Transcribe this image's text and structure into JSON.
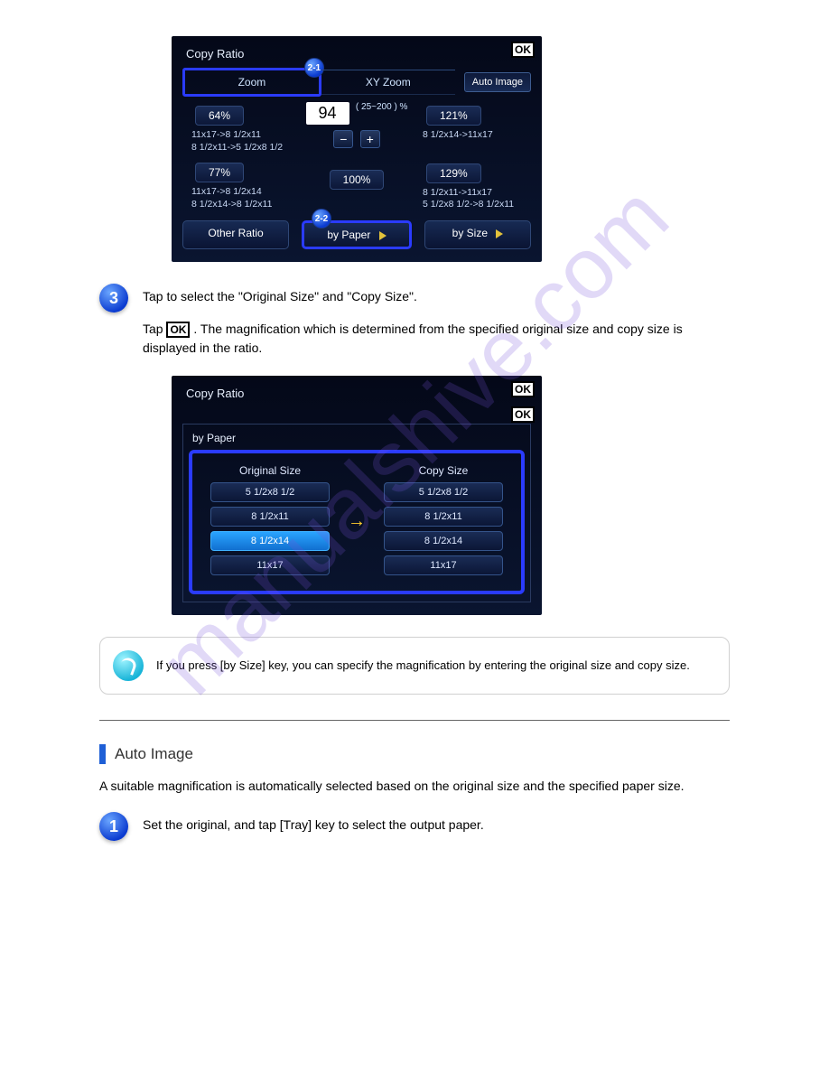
{
  "watermark": "manualshive.com",
  "screen1": {
    "title": "Copy Ratio",
    "ok": "OK",
    "marker_top": "2-1",
    "marker_bottom": "2-2",
    "tabs": {
      "zoom": "Zoom",
      "xyzoom": "XY Zoom",
      "autoimage": "Auto Image"
    },
    "left": {
      "p1": "64%",
      "d1a": "11x17->8 1/2x11",
      "d1b": "8 1/2x11->5 1/2x8 1/2",
      "p2": "77%",
      "d2a": "11x17->8 1/2x14",
      "d2b": "8 1/2x14->8 1/2x11"
    },
    "center": {
      "value": "94",
      "range": "( 25~200 )\n%",
      "minus": "−",
      "plus": "+",
      "hundred": "100%"
    },
    "right": {
      "p1": "121%",
      "d1a": "8 1/2x14->11x17",
      "p2": "129%",
      "d2a": "8 1/2x11->11x17",
      "d2b": "5 1/2x8 1/2->8 1/2x11"
    },
    "bottom": {
      "other": "Other Ratio",
      "bypaper": "by Paper",
      "bysize": "by Size"
    }
  },
  "step3": {
    "num": "3",
    "line1": "Tap to select the \"Original Size\" and \"Copy Size\".",
    "sub_prefix": "Tap ",
    "sub_ok": "OK",
    "sub_suffix": ". The magnification which is determined from the specified original size and copy size is displayed in the ratio."
  },
  "screen2": {
    "title": "Copy Ratio",
    "ok": "OK",
    "sublabel": "by Paper",
    "ok2": "OK",
    "orig_head": "Original Size",
    "copy_head": "Copy Size",
    "sizes_left": [
      "5 1/2x8 1/2",
      "8 1/2x11",
      "8 1/2x14",
      "11x17"
    ],
    "sizes_right": [
      "5 1/2x8 1/2",
      "8 1/2x11",
      "8 1/2x14",
      "11x17"
    ],
    "arrow": "→"
  },
  "note": {
    "text": "If you press [by Size] key, you can specify the magnification by entering the original size and copy size."
  },
  "section": {
    "title": "Auto Image",
    "desc": "A suitable magnification is automatically selected based on the original size and the specified paper size."
  },
  "step1": {
    "num": "1",
    "text": "Set the original, and tap [Tray] key to select the output paper."
  }
}
